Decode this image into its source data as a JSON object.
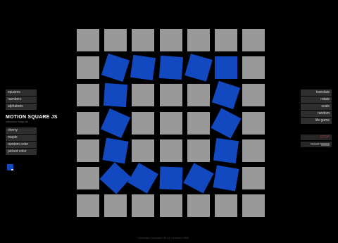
{
  "app": {
    "title": "MOTION SQUARE JS",
    "subtitle": "interactive image lab",
    "footer": "Ciaramia Compania 09 14 Licenses 2020"
  },
  "left_menu": {
    "top": [
      {
        "name": "squares",
        "label": "squares"
      },
      {
        "name": "numbers",
        "label": "numbers"
      },
      {
        "name": "alphabets",
        "label": "alphabets"
      }
    ],
    "bottom": [
      {
        "name": "cherry",
        "label": "cherry"
      },
      {
        "name": "maple",
        "label": "maple"
      },
      {
        "name": "random-color",
        "label": "random color"
      },
      {
        "name": "picked-color",
        "label": "picked color"
      }
    ]
  },
  "right_menu": [
    {
      "name": "translate",
      "label": "translate"
    },
    {
      "name": "rotate",
      "label": "rotate"
    },
    {
      "name": "scale",
      "label": "scale"
    },
    {
      "name": "random",
      "label": "random"
    },
    {
      "name": "life-game",
      "label": "life game"
    }
  ],
  "controls": {
    "stop_label": "STOP",
    "reset_label": "RESET"
  },
  "colors": {
    "background": "#000000",
    "gray_square": "#999999",
    "blue_square": "#1248c0",
    "stop_text": "#c8202a"
  },
  "grid": {
    "rows": 7,
    "cols": 7,
    "cells": [
      {
        "r": 1,
        "c": 1,
        "rot": 18
      },
      {
        "r": 1,
        "c": 2,
        "rot": 8
      },
      {
        "r": 1,
        "c": 3,
        "rot": 4
      },
      {
        "r": 1,
        "c": 4,
        "rot": 16
      },
      {
        "r": 1,
        "c": 5,
        "rot": 0
      },
      {
        "r": 2,
        "c": 1,
        "rot": 4
      },
      {
        "r": 2,
        "c": 5,
        "rot": 18
      },
      {
        "r": 3,
        "c": 1,
        "rot": 24
      },
      {
        "r": 3,
        "c": 5,
        "rot": 28
      },
      {
        "r": 4,
        "c": 1,
        "rot": 10
      },
      {
        "r": 4,
        "c": 5,
        "rot": 8
      },
      {
        "r": 5,
        "c": 1,
        "rot": 42
      },
      {
        "r": 5,
        "c": 2,
        "rot": 30
      },
      {
        "r": 5,
        "c": 3,
        "rot": 2
      },
      {
        "r": 5,
        "c": 4,
        "rot": 28
      },
      {
        "r": 5,
        "c": 5,
        "rot": 10
      }
    ]
  }
}
